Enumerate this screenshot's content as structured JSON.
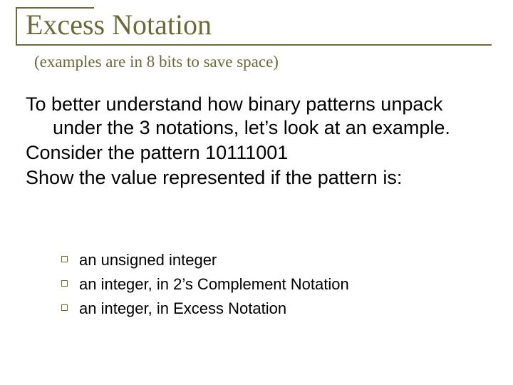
{
  "title": "Excess Notation",
  "subtitle": "(examples are in 8 bits to save space)",
  "body": {
    "p1": "To better understand how binary patterns unpack under the 3 notations, let’s look at an example.",
    "p2": "Consider the pattern 10111001",
    "p3": "Show the value represented if the pattern is:"
  },
  "sublist": {
    "items": [
      {
        "label": "an unsigned integer"
      },
      {
        "label": "an integer, in 2’s Complement Notation"
      },
      {
        "label": "an integer, in Excess Notation"
      }
    ]
  }
}
